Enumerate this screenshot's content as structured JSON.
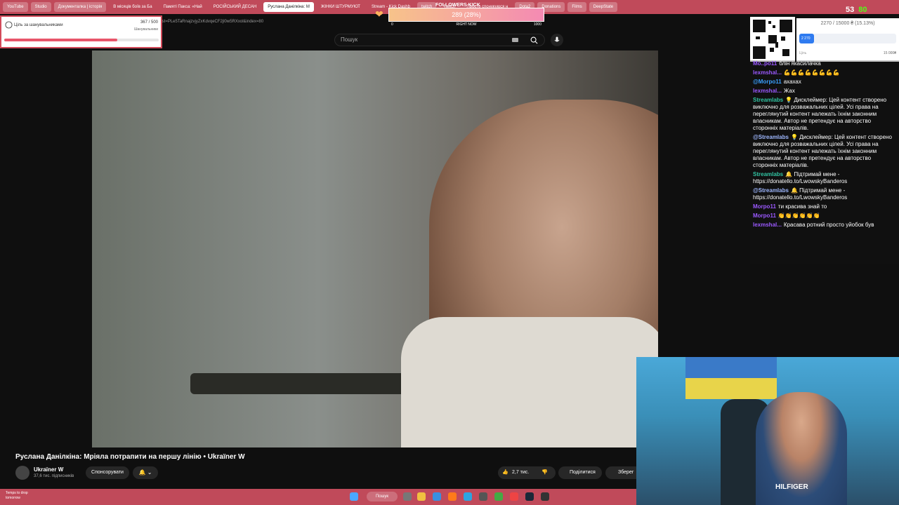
{
  "tabs": [
    {
      "label": "YouTube",
      "small": true
    },
    {
      "label": "Studio",
      "small": true
    },
    {
      "label": "Документалка | історія",
      "small": true
    },
    {
      "label": "В місяців боїв за Ба",
      "small": false
    },
    {
      "label": "Памяті Пакса: «Най",
      "small": false
    },
    {
      "label": "РОСІЙСЬКИЙ ДЕСАН",
      "small": false
    },
    {
      "label": "Руслана Данілкіна: М",
      "active": true
    },
    {
      "label": "ЖІНКИ ШТУРМУЮТ",
      "small": false
    },
    {
      "label": "Stream - Kick Dashb",
      "small": false
    },
    {
      "label": "twitch",
      "small": true
    },
    {
      "label": "Twitch",
      "small": false
    },
    {
      "label": "Просто спонукуюся н",
      "small": false
    },
    {
      "label": "Dota2",
      "small": true
    },
    {
      "label": "Donations",
      "small": true
    },
    {
      "label": "Films",
      "small": true
    },
    {
      "label": "DeepState",
      "small": true
    }
  ],
  "url": "list=PLe5TaRnajzvjyZxKdvqeCF2jl0w5RXxol&index=80",
  "search": {
    "placeholder": "Пошук"
  },
  "goal_widget": {
    "title": "Ціль за шанувальниками",
    "count": "367 / 500",
    "subtitle": "Шанувальники",
    "progress": 0.734
  },
  "followers_widget": {
    "title": "FOLLOWERS KICK",
    "count": "289 (28%)",
    "min": "0",
    "center": "RIGHT NOW",
    "max": "1000",
    "progress": 0.289
  },
  "donate_widget": {
    "text": "2270 / 15000 ₴ (15.13%)",
    "bar_label": "2 270",
    "label": "Ціль",
    "max": "15 000₴",
    "progress": 0.1513
  },
  "viewers": {
    "youtube": "53",
    "kick": "80"
  },
  "video": {
    "title": "Руслана Данілкіна: Мріяла потрапити на першу лінію • Ukraїner W",
    "channel": "Ukraїner W",
    "subscribers": "37,6 тис. підписників",
    "sponsor_label": "Спонсорувати",
    "bell_label": "🔔 ⌄",
    "likes": "2,7 тис.",
    "share_label": "Поділитися",
    "save_label": "Зберег"
  },
  "chat": [
    {
      "user": "Mo..po11",
      "text": "блін якасилачка",
      "color": "#9b59ff"
    },
    {
      "user": "lexmshal...",
      "text": "💪💪💪💪💪💪💪💪",
      "color": "#9b59ff"
    },
    {
      "user": "@Morpo11",
      "text": "ахахах",
      "color": "#3aa0ff"
    },
    {
      "user": "lexmshal...",
      "text": "Жах",
      "color": "#9b59ff"
    },
    {
      "user": "Streamlabs",
      "text": "💡 Дисклеймер: Цей контент створено виключно для розважальних цілей. Усі права на переглянутий контент належать їхнім законним власникам. Автор не претендує на авторство сторонніх матеріалів.",
      "color": "#31c3a2"
    },
    {
      "user": "@Streamlabs",
      "text": "💡 Дисклеймер: Цей контент створено виключно для розважальних цілей. Усі права на переглянутий контент належать їхнім законним власникам. Автор не претендує на авторство сторонніх матеріалів.",
      "color": "#9fb8ff"
    },
    {
      "user": "Streamlabs",
      "text": "🔔 Підтримай мене - https://donatello.to/LwowskyBanderos",
      "color": "#31c3a2"
    },
    {
      "user": "@Streamlabs",
      "text": "🔔 Підтримай мене - https://donatello.to/LwowskyBanderos",
      "color": "#9fb8ff"
    },
    {
      "user": "Morpo11",
      "text": "ти красива знай то",
      "color": "#9b59ff"
    },
    {
      "user": "Morpo11",
      "text": "👏👏👏👏👏👏",
      "color": "#9b59ff"
    },
    {
      "user": "lexmshal...",
      "text": "Красава ротний просто уйобок був",
      "color": "#9b59ff"
    }
  ],
  "taskbar": {
    "weather_line1": "Temps to drop",
    "weather_line2": "tomorrow",
    "search_label": "Пошук"
  },
  "webcam_text": "HILFIGER",
  "colors": {
    "tabbar": "#c04a5a",
    "goal_fill": "#e8556a",
    "donate_fill": "#2f7bf0",
    "kick_green": "#53fc18"
  },
  "icons": [
    "search-icon",
    "mic-icon",
    "keyboard-icon",
    "bell-icon",
    "thumbs-up-icon",
    "thumbs-down-icon",
    "share-icon",
    "save-icon",
    "heart-icon",
    "windows-icon"
  ]
}
